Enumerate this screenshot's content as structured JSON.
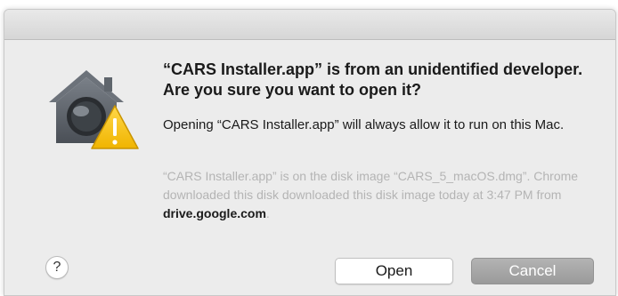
{
  "dialog": {
    "icon": "gatekeeper-warning-icon",
    "headline": "“CARS Installer.app” is from an unidentified developer. Are you sure you want to open it?",
    "body": "Opening “CARS Installer.app” will always allow it to run on this Mac.",
    "info_text": "“CARS Installer.app” is on the disk image “CARS_5_macOS.dmg”. Chrome downloaded this disk downloaded this disk image today at 3:47 PM from ",
    "info_link": "drive.google.com",
    "info_suffix": "."
  },
  "buttons": {
    "help_label": "?",
    "open_label": "Open",
    "cancel_label": "Cancel"
  },
  "colors": {
    "window_bg": "#ececec",
    "warning_yellow": "#f5c316",
    "muted_text": "#b4b4b4",
    "cancel_bg": "#a6a6a6"
  }
}
